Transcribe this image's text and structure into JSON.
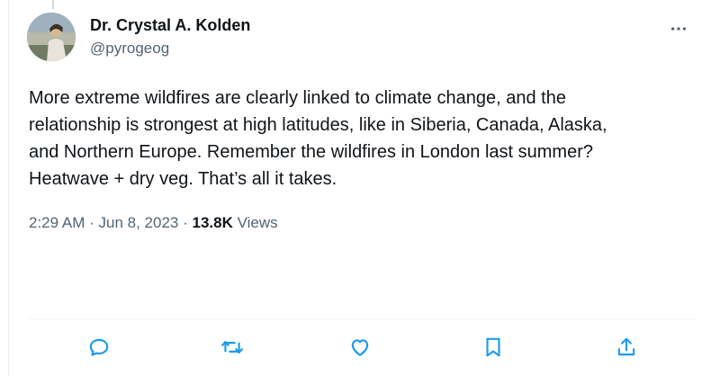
{
  "author": {
    "name": "Dr. Crystal A. Kolden",
    "handle": "@pyrogeog"
  },
  "tweet": {
    "lines": [
      "More extreme wildfires are clearly linked to climate change, and the",
      "relationship is strongest at high latitudes, like in Siberia, Canada, Alaska,",
      "and Northern Europe. Remember the wildfires in London last summer?",
      "Heatwave + dry veg. That’s all it takes."
    ]
  },
  "meta": {
    "time": "2:29 AM",
    "date": "Jun 8, 2023",
    "views_count": "13.8K",
    "views_label": "Views",
    "separator": "·"
  },
  "icons": {
    "more": "more-horizontal-icon",
    "reply": "reply-icon",
    "retweet": "retweet-icon",
    "like": "like-icon",
    "bookmark": "bookmark-icon",
    "share": "share-icon"
  },
  "colors": {
    "accent_icon": "#1d9bf0",
    "secondary_text": "#536471",
    "primary_text": "#0f1419"
  }
}
